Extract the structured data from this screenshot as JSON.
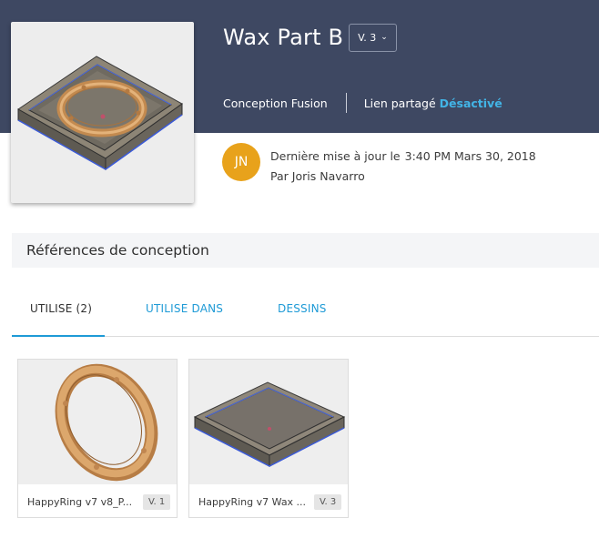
{
  "design": {
    "title": "Wax Part B",
    "version": "V. 3",
    "type": "Conception Fusion",
    "shared_link_label": "Lien partagé",
    "shared_link_status": "Désactivé",
    "thumbnail_icon": "tray-with-ring-model-thumbnail"
  },
  "updated": {
    "avatar_initials": "JN",
    "avatar_color": "#e8a21b",
    "label": "Dernière mise à jour le",
    "timestamp": "3:40 PM Mars 30, 2018",
    "by_label": "Par",
    "author": "Joris Navarro"
  },
  "references": {
    "title": "Références de conception",
    "tabs": [
      {
        "label": "UTILISE (2)",
        "active": true
      },
      {
        "label": "UTILISE DANS",
        "active": false
      },
      {
        "label": "DESSINS",
        "active": false
      }
    ],
    "items": [
      {
        "name": "HappyRing v7 v8_P...",
        "version": "V. 1",
        "icon": "ring-model-thumbnail"
      },
      {
        "name": "HappyRing v7 Wax ...",
        "version": "V. 3",
        "icon": "tray-model-thumbnail"
      }
    ]
  },
  "colors": {
    "header_bg": "#3e4862",
    "accent": "#1e9ad6",
    "shared_status": "#42b4e6"
  }
}
